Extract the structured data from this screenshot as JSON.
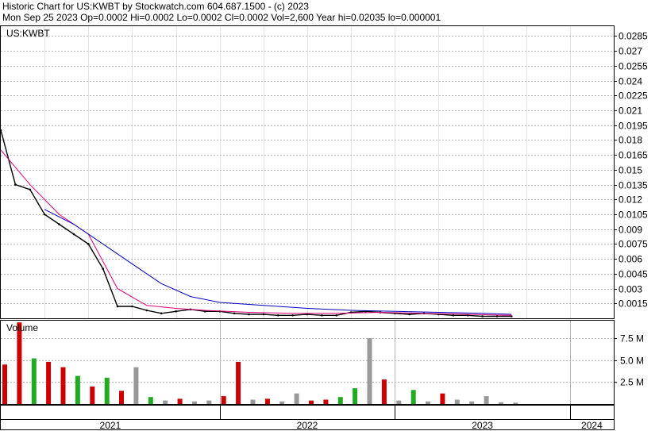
{
  "header": {
    "title": "Historic Chart for US:KWBT by Stockwatch.com 604.687.1500 - (c) 2023",
    "quote": "Mon Sep 25 2023   Op=0.0002   Hi=0.0002   Lo=0.0002   Cl=0.0002   Vol=2,600   Year hi=0.02035   lo=0.000001"
  },
  "chart_data": [
    {
      "type": "line",
      "panel": "price",
      "symbol_label": "US:KWBT",
      "ylim": [
        0,
        0.0295
      ],
      "y_ticks": [
        "0.0015",
        "0.003",
        "0.0045",
        "0.006",
        "0.0075",
        "0.009",
        "0.0105",
        "0.012",
        "0.0135",
        "0.015",
        "0.0165",
        "0.018",
        "0.0195",
        "0.021",
        "0.0225",
        "0.024",
        "0.0255",
        "0.027",
        "0.0285"
      ],
      "x_ticks": [
        "2021",
        "2022",
        "2023",
        "2024"
      ],
      "grid": true,
      "colors": {
        "price": "#000000",
        "ma_short": "#e0007a",
        "ma_long": "#0000c0",
        "recent": "#cc0000",
        "grid": "#b5b5b5"
      },
      "series": [
        {
          "role": "price",
          "x": [
            "2020-10",
            "2020-11",
            "2020-12",
            "2021-01",
            "2021-02",
            "2021-03",
            "2021-04",
            "2021-05",
            "2021-06",
            "2021-07",
            "2021-08",
            "2021-09",
            "2021-10",
            "2021-11",
            "2021-12",
            "2022-01",
            "2022-02",
            "2022-03",
            "2022-04",
            "2022-05",
            "2022-06",
            "2022-07",
            "2022-08",
            "2022-09",
            "2022-10",
            "2022-11",
            "2022-12",
            "2023-01",
            "2023-02",
            "2023-03",
            "2023-04",
            "2023-05",
            "2023-06",
            "2023-07",
            "2023-08",
            "2023-09"
          ],
          "y": [
            0.019,
            0.0135,
            0.013,
            0.0105,
            0.0095,
            0.0085,
            0.0075,
            0.005,
            0.0012,
            0.0012,
            0.0008,
            0.0005,
            0.0007,
            0.0009,
            0.0007,
            0.0007,
            0.0005,
            0.0004,
            0.0004,
            0.0003,
            0.0003,
            0.0004,
            0.0003,
            0.0003,
            0.0006,
            0.0007,
            0.0006,
            0.0005,
            0.0004,
            0.0005,
            0.0004,
            0.0003,
            0.0003,
            0.0002,
            0.0002,
            0.0002
          ]
        },
        {
          "role": "ma_short",
          "x": [
            "2020-10",
            "2020-12",
            "2021-02",
            "2021-04",
            "2021-06",
            "2021-08",
            "2021-10",
            "2021-12",
            "2022-03",
            "2022-06",
            "2022-09",
            "2022-12",
            "2023-03",
            "2023-06",
            "2023-09"
          ],
          "y": [
            0.017,
            0.0135,
            0.0105,
            0.0085,
            0.003,
            0.0013,
            0.001,
            0.0008,
            0.0006,
            0.0005,
            0.0005,
            0.0006,
            0.0005,
            0.0004,
            0.0003
          ]
        },
        {
          "role": "ma_long",
          "x": [
            "2021-01",
            "2021-03",
            "2021-05",
            "2021-07",
            "2021-09",
            "2021-11",
            "2022-01",
            "2022-04",
            "2022-07",
            "2022-10",
            "2023-01",
            "2023-04",
            "2023-07",
            "2023-09"
          ],
          "y": [
            0.011,
            0.0095,
            0.0075,
            0.0055,
            0.0035,
            0.0022,
            0.0016,
            0.0013,
            0.001,
            0.0008,
            0.0007,
            0.0006,
            0.0005,
            0.0004
          ]
        }
      ]
    },
    {
      "type": "bar",
      "panel": "volume",
      "label": "Volume",
      "ylim": [
        0,
        9500000
      ],
      "y_ticks": [
        "2.5 M",
        "5.0 M",
        "7.5 M"
      ],
      "colors": {
        "up": "#22aa22",
        "down": "#cc0000",
        "flat": "#999999"
      },
      "x": [
        "2020-10",
        "2020-11",
        "2020-12",
        "2021-01",
        "2021-02",
        "2021-03",
        "2021-04",
        "2021-05",
        "2021-06",
        "2021-07",
        "2021-08",
        "2021-09",
        "2021-10",
        "2021-11",
        "2021-12",
        "2022-01",
        "2022-02",
        "2022-03",
        "2022-04",
        "2022-05",
        "2022-06",
        "2022-07",
        "2022-08",
        "2022-09",
        "2022-10",
        "2022-11",
        "2022-12",
        "2023-01",
        "2023-02",
        "2023-03",
        "2023-04",
        "2023-05",
        "2023-06",
        "2023-07",
        "2023-08",
        "2023-09"
      ],
      "values": [
        4500000,
        9300000,
        5200000,
        4800000,
        4200000,
        3200000,
        2000000,
        3000000,
        1500000,
        4200000,
        800000,
        400000,
        600000,
        300000,
        400000,
        900000,
        4800000,
        500000,
        600000,
        300000,
        1200000,
        400000,
        500000,
        800000,
        1800000,
        7500000,
        2800000,
        400000,
        1600000,
        300000,
        1200000,
        500000,
        300000,
        900000,
        200000,
        150000
      ],
      "direction": [
        "down",
        "down",
        "up",
        "down",
        "down",
        "up",
        "down",
        "up",
        "down",
        "flat",
        "up",
        "flat",
        "down",
        "flat",
        "flat",
        "down",
        "down",
        "flat",
        "down",
        "flat",
        "flat",
        "down",
        "down",
        "up",
        "up",
        "flat",
        "down",
        "flat",
        "up",
        "flat",
        "down",
        "flat",
        "flat",
        "flat",
        "flat",
        "flat"
      ]
    }
  ]
}
